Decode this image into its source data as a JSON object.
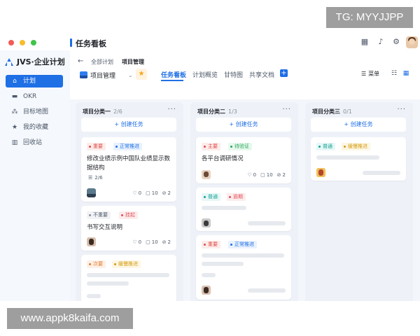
{
  "watermarks": {
    "top": "TG: MYYJJPP",
    "bottom": "www.appk8kaifa.com"
  },
  "window": {
    "title": "任务看板"
  },
  "sidebar": {
    "brand": "JVS·企业计划",
    "items": [
      {
        "label": "计划",
        "icon": "home-icon",
        "active": true
      },
      {
        "label": "OKR",
        "icon": "folder-icon",
        "active": false
      },
      {
        "label": "目标地图",
        "icon": "org-icon",
        "active": false
      },
      {
        "label": "我的收藏",
        "icon": "star-icon",
        "active": false
      },
      {
        "label": "回收站",
        "icon": "trash-icon",
        "active": false
      }
    ]
  },
  "header": {
    "breadcrumb": [
      "全部计划",
      "项目管理"
    ],
    "project": "项目管理",
    "tabs": [
      "任务看板",
      "计划概览",
      "甘特图",
      "共享文档"
    ],
    "menu_label": "菜单"
  },
  "columns": [
    {
      "title": "项目分类一",
      "count": "2/6",
      "create_label": "创建任务",
      "cards": [
        {
          "tags": [
            {
              "text": "重要",
              "color": "red"
            },
            {
              "text": "正常推进",
              "color": "blue"
            }
          ],
          "title": "修改业绩示例中国队业绩显示数据结构",
          "subtasks": "2/6",
          "stats": {
            "likes": "0",
            "comments": "10",
            "attachments": "2"
          }
        },
        {
          "tags": [
            {
              "text": "不重要",
              "color": "gray"
            },
            {
              "text": "挂起",
              "color": "pink"
            }
          ],
          "title": "书写交互说明",
          "stats": {
            "likes": "0",
            "comments": "10",
            "attachments": "2"
          }
        },
        {
          "tags": [
            {
              "text": "次要",
              "color": "orange"
            },
            {
              "text": "缓慢推进",
              "color": "yellow"
            }
          ]
        }
      ]
    },
    {
      "title": "项目分类二",
      "count": "1/3",
      "create_label": "创建任务",
      "cards": [
        {
          "tags": [
            {
              "text": "主要",
              "color": "red"
            },
            {
              "text": "待验证",
              "color": "green"
            }
          ],
          "title": "各平台调研情况",
          "stats": {
            "likes": "0",
            "comments": "10",
            "attachments": "2"
          }
        },
        {
          "tags": [
            {
              "text": "普通",
              "color": "teal"
            },
            {
              "text": "逾期",
              "color": "pink"
            }
          ]
        },
        {
          "tags": [
            {
              "text": "重要",
              "color": "red"
            },
            {
              "text": "正常推进",
              "color": "blue"
            }
          ]
        }
      ]
    },
    {
      "title": "项目分类三",
      "count": "0/1",
      "create_label": "创建任务",
      "cards": [
        {
          "tags": [
            {
              "text": "普通",
              "color": "teal"
            },
            {
              "text": "缓慢推进",
              "color": "yellow"
            }
          ]
        }
      ]
    }
  ]
}
